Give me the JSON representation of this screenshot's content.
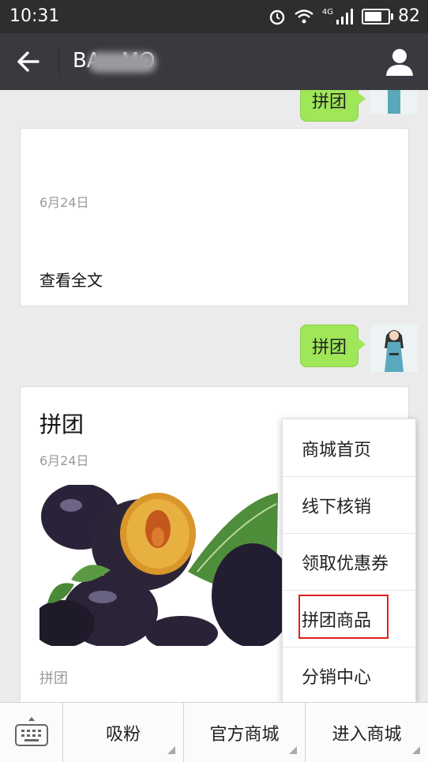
{
  "status": {
    "time": "10:31",
    "network": "4G",
    "battery": "82",
    "battery_level": 0.82
  },
  "header": {
    "title": "BA…MO",
    "back_icon": "back-arrow-icon",
    "profile_icon": "person-icon"
  },
  "chat": {
    "messages": [
      {
        "type": "text",
        "text": "拼团"
      },
      {
        "type": "article",
        "date": "6月24日",
        "link": "查看全文"
      },
      {
        "type": "text",
        "text": "拼团"
      },
      {
        "type": "article",
        "title": "拼团",
        "date": "6月24日",
        "tag": "拼团"
      }
    ]
  },
  "menu": {
    "items": [
      "商城首页",
      "线下核销",
      "领取优惠券",
      "拼团商品",
      "分销中心"
    ],
    "highlighted": "拼团商品",
    "highlight_color": "#e02020"
  },
  "bottom_bar": {
    "keyboard_icon": "keyboard-icon",
    "tabs": [
      "吸粉",
      "官方商城",
      "进入商城"
    ]
  },
  "colors": {
    "accent_bubble": "#9fe658",
    "header_bg": "#393a3f"
  }
}
